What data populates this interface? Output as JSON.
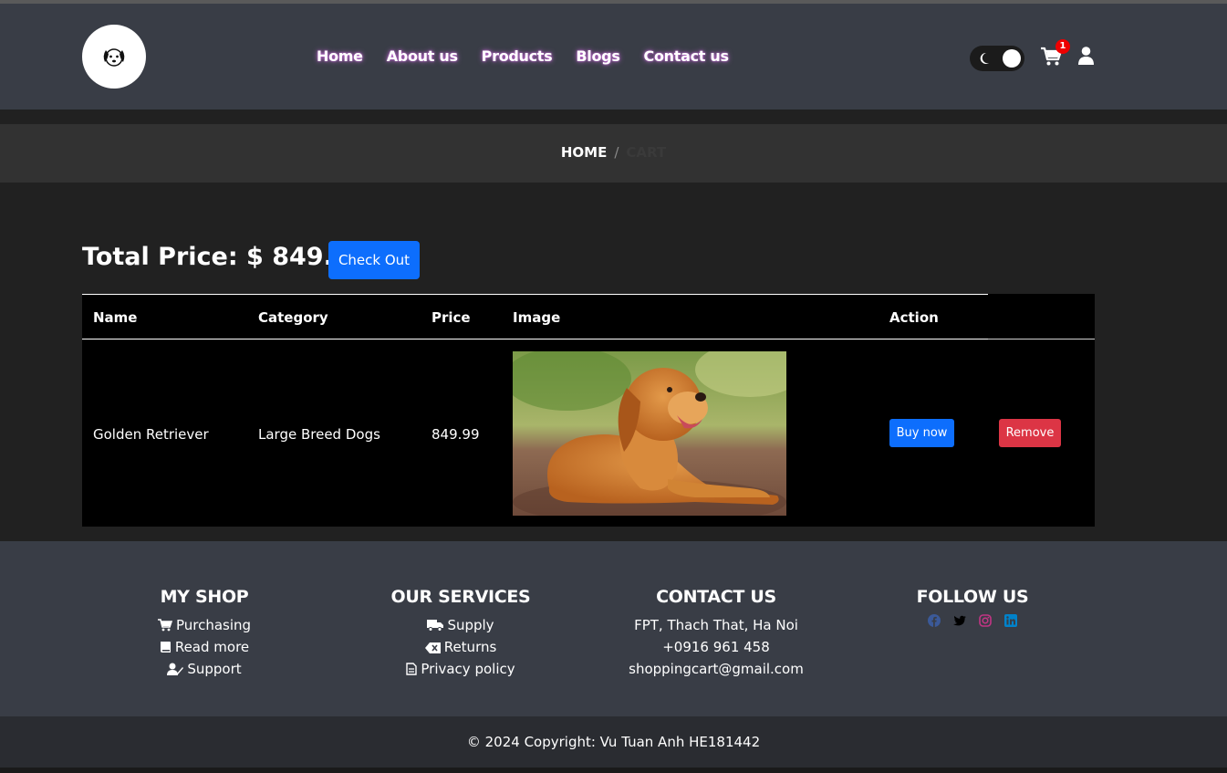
{
  "header": {
    "nav": [
      "Home",
      "About us",
      "Products",
      "Blogs",
      "Contact us"
    ],
    "cart_count": "1"
  },
  "breadcrumb": {
    "home": "HOME",
    "separator": "/",
    "current": "CART"
  },
  "cart": {
    "total_label": "Total Price: $ 849.99",
    "checkout_label": "Check Out",
    "columns": [
      "Name",
      "Category",
      "Price",
      "Image",
      "Action"
    ],
    "rows": [
      {
        "name": "Golden Retriever",
        "category": "Large Breed Dogs",
        "price": "849.99",
        "buy_label": "Buy now",
        "remove_label": "Remove"
      }
    ]
  },
  "footer": {
    "my_shop": {
      "title": "MY SHOP",
      "items": [
        "Purchasing",
        "Read more",
        "Support"
      ]
    },
    "services": {
      "title": "OUR SERVICES",
      "items": [
        "Supply",
        "Returns",
        "Privacy policy"
      ]
    },
    "contact": {
      "title": "CONTACT US",
      "items": [
        "FPT, Thach That, Ha Noi",
        "+0916 961 458",
        "shoppingcart@gmail.com"
      ]
    },
    "follow": {
      "title": "FOLLOW US",
      "icons": [
        "facebook-icon",
        "twitter-icon",
        "instagram-icon",
        "linkedin-icon"
      ]
    },
    "copyright": "© 2024 Copyright: Vu Tuan Anh HE181442"
  },
  "colors": {
    "primary": "#0d6efd",
    "danger": "#dc3545",
    "header_bg": "#393d46",
    "badge": "#ee0000"
  }
}
